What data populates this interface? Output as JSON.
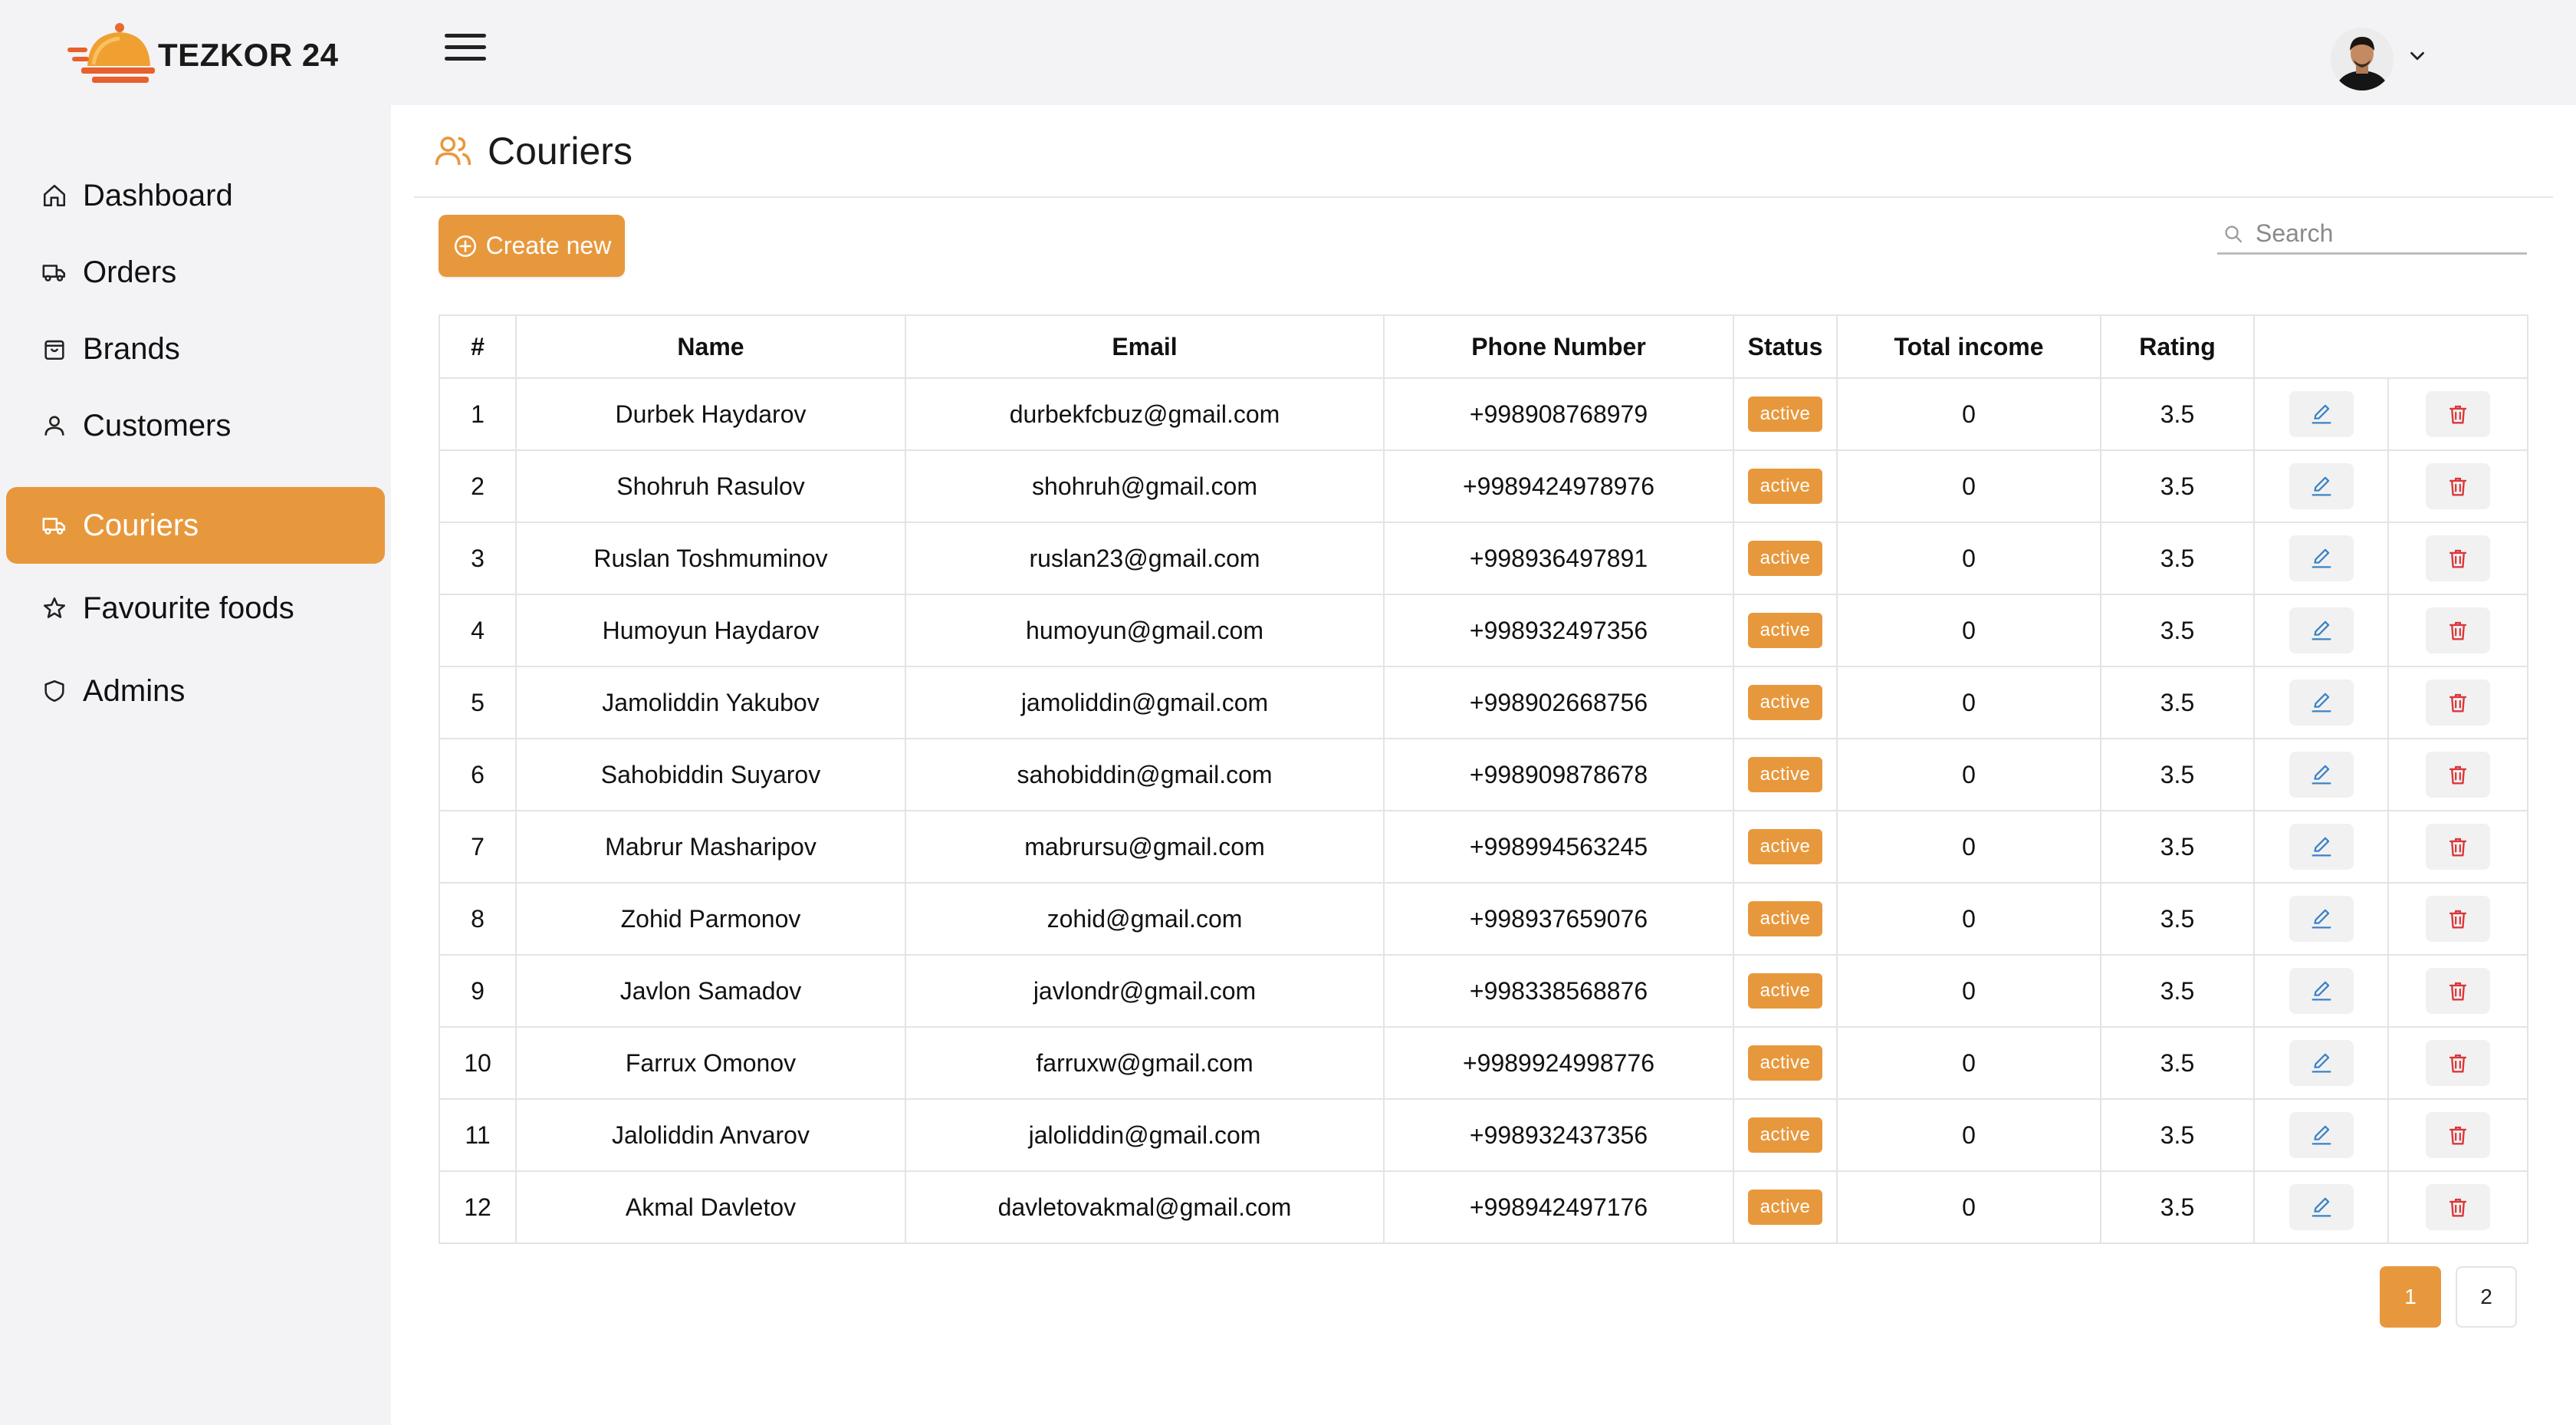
{
  "app": {
    "brand": "TEZKOR 24"
  },
  "sidebar": {
    "items": [
      {
        "label": "Dashboard",
        "icon": "home-icon"
      },
      {
        "label": "Orders",
        "icon": "truck-icon"
      },
      {
        "label": "Brands",
        "icon": "bag-icon"
      },
      {
        "label": "Customers",
        "icon": "user-icon"
      },
      {
        "label": "Couriers",
        "icon": "truck-icon",
        "active": true
      },
      {
        "label": "Favourite foods",
        "icon": "star-icon"
      },
      {
        "label": "Admins",
        "icon": "shield-icon"
      }
    ]
  },
  "page": {
    "title": "Couriers",
    "icon": "users-icon"
  },
  "toolbar": {
    "create_label": "Create new",
    "search_placeholder": "Search"
  },
  "table": {
    "headers": [
      "#",
      "Name",
      "Email",
      "Phone Number",
      "Status",
      "Total income",
      "Rating",
      ""
    ],
    "rows": [
      {
        "no": "1",
        "name": "Durbek Haydarov",
        "email": "durbekfcbuz@gmail.com",
        "phone": "+998908768979",
        "status": "active",
        "income": "0",
        "rating": "3.5"
      },
      {
        "no": "2",
        "name": "Shohruh Rasulov",
        "email": "shohruh@gmail.com",
        "phone": "+9989424978976",
        "status": "active",
        "income": "0",
        "rating": "3.5"
      },
      {
        "no": "3",
        "name": "Ruslan Toshmuminov",
        "email": "ruslan23@gmail.com",
        "phone": "+998936497891",
        "status": "active",
        "income": "0",
        "rating": "3.5"
      },
      {
        "no": "4",
        "name": "Humoyun Haydarov",
        "email": "humoyun@gmail.com",
        "phone": "+998932497356",
        "status": "active",
        "income": "0",
        "rating": "3.5"
      },
      {
        "no": "5",
        "name": "Jamoliddin Yakubov",
        "email": "jamoliddin@gmail.com",
        "phone": "+998902668756",
        "status": "active",
        "income": "0",
        "rating": "3.5"
      },
      {
        "no": "6",
        "name": "Sahobiddin Suyarov",
        "email": "sahobiddin@gmail.com",
        "phone": "+998909878678",
        "status": "active",
        "income": "0",
        "rating": "3.5"
      },
      {
        "no": "7",
        "name": "Mabrur Masharipov",
        "email": "mabrursu@gmail.com",
        "phone": "+998994563245",
        "status": "active",
        "income": "0",
        "rating": "3.5"
      },
      {
        "no": "8",
        "name": "Zohid Parmonov",
        "email": "zohid@gmail.com",
        "phone": "+998937659076",
        "status": "active",
        "income": "0",
        "rating": "3.5"
      },
      {
        "no": "9",
        "name": "Javlon Samadov",
        "email": "javlondr@gmail.com",
        "phone": "+998338568876",
        "status": "active",
        "income": "0",
        "rating": "3.5"
      },
      {
        "no": "10",
        "name": "Farrux Omonov",
        "email": "farruxw@gmail.com",
        "phone": "+9989924998776",
        "status": "active",
        "income": "0",
        "rating": "3.5"
      },
      {
        "no": "11",
        "name": "Jaloliddin Anvarov",
        "email": "jaloliddin@gmail.com",
        "phone": "+998932437356",
        "status": "active",
        "income": "0",
        "rating": "3.5"
      },
      {
        "no": "12",
        "name": "Akmal Davletov",
        "email": "davletovakmal@gmail.com",
        "phone": "+998942497176",
        "status": "active",
        "income": "0",
        "rating": "3.5"
      }
    ]
  },
  "pagination": {
    "pages": [
      "1",
      "2"
    ],
    "current": "1"
  },
  "colors": {
    "accent": "#e8983c",
    "edit_icon": "#3b82c4",
    "delete_icon": "#d9383a",
    "sidebar_bg": "#f3f3f5"
  }
}
